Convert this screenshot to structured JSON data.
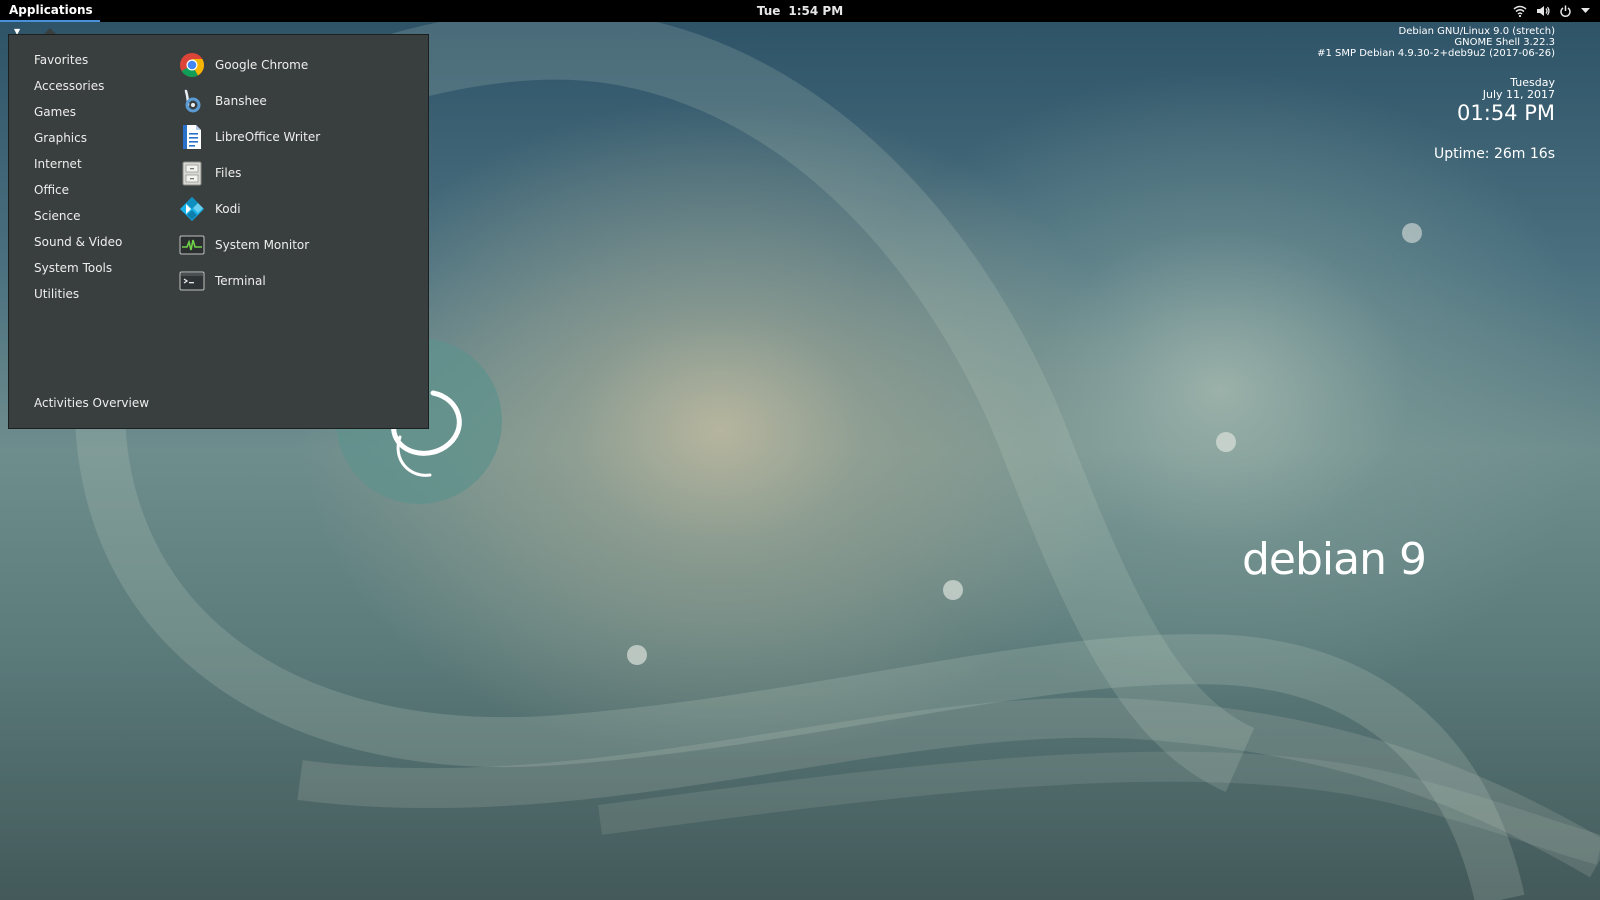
{
  "topbar": {
    "applications_label": "Applications",
    "clock_day": "Tue",
    "clock_time": "1:54 PM",
    "tray_icons": [
      "wifi-icon",
      "volume-icon",
      "power-icon",
      "chevron-down-icon"
    ]
  },
  "menu": {
    "categories": [
      {
        "label": "Favorites"
      },
      {
        "label": "Accessories"
      },
      {
        "label": "Games"
      },
      {
        "label": "Graphics"
      },
      {
        "label": "Internet"
      },
      {
        "label": "Office"
      },
      {
        "label": "Science"
      },
      {
        "label": "Sound & Video"
      },
      {
        "label": "System Tools"
      },
      {
        "label": "Utilities"
      }
    ],
    "apps": [
      {
        "label": "Google Chrome",
        "icon": "chrome-icon"
      },
      {
        "label": "Banshee",
        "icon": "banshee-icon"
      },
      {
        "label": "LibreOffice Writer",
        "icon": "libreoffice-writer-icon"
      },
      {
        "label": "Files",
        "icon": "files-icon"
      },
      {
        "label": "Kodi",
        "icon": "kodi-icon"
      },
      {
        "label": "System Monitor",
        "icon": "system-monitor-icon"
      },
      {
        "label": "Terminal",
        "icon": "terminal-icon"
      }
    ],
    "activities_overview": "Activities Overview"
  },
  "sysinfo": {
    "line1": "Debian GNU/Linux 9.0 (stretch)",
    "line2": "GNOME Shell 3.22.3",
    "line3": "#1 SMP Debian 4.9.30-2+deb9u2 (2017-06-26)",
    "weekday": "Tuesday",
    "date": "July 11, 2017",
    "time": "01:54 PM",
    "uptime": "Uptime: 26m 16s"
  },
  "wallpaper": {
    "brand": "debian 9"
  },
  "colors": {
    "topbar": "#000000",
    "menu_bg": "#393f3f",
    "accent": "#4a90d9"
  }
}
